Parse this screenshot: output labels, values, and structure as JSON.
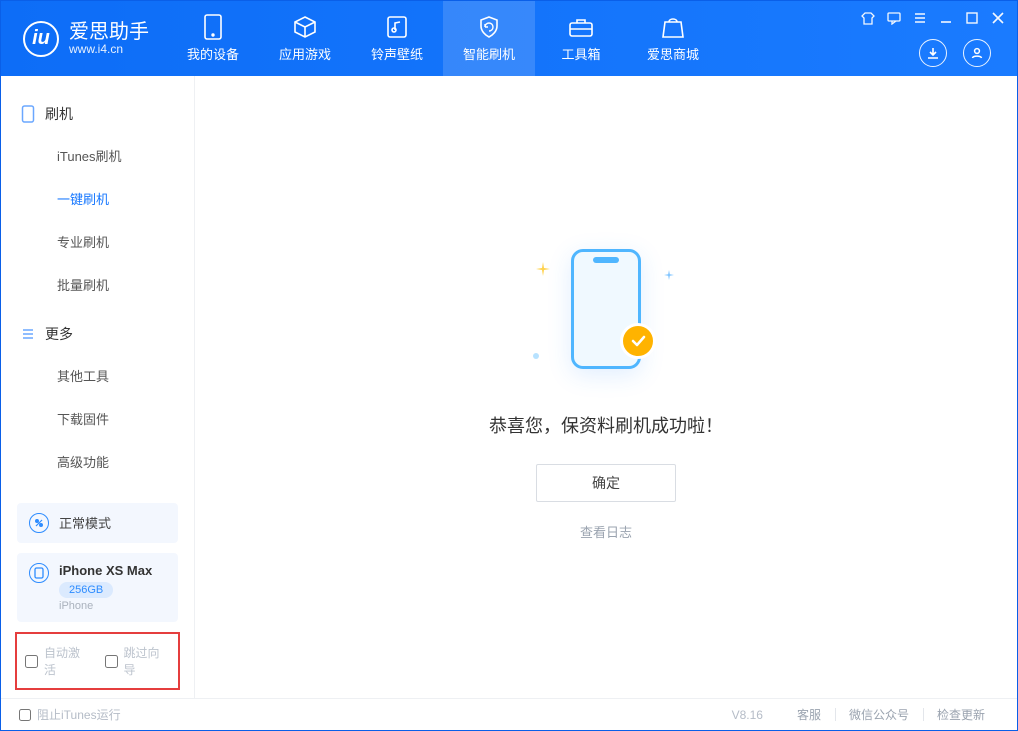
{
  "brand": {
    "name": "爱思助手",
    "url": "www.i4.cn"
  },
  "tabs": [
    {
      "label": "我的设备",
      "icon": "device"
    },
    {
      "label": "应用游戏",
      "icon": "cube"
    },
    {
      "label": "铃声壁纸",
      "icon": "music"
    },
    {
      "label": "智能刷机",
      "icon": "shield",
      "active": true
    },
    {
      "label": "工具箱",
      "icon": "toolbox"
    },
    {
      "label": "爱思商城",
      "icon": "bag"
    }
  ],
  "sidebar": {
    "g1": {
      "title": "刷机",
      "items": [
        "iTunes刷机",
        "一键刷机",
        "专业刷机",
        "批量刷机"
      ],
      "active_index": 1
    },
    "g2": {
      "title": "更多",
      "items": [
        "其他工具",
        "下载固件",
        "高级功能"
      ]
    },
    "mode_card": {
      "label": "正常模式"
    },
    "device_card": {
      "name": "iPhone XS Max",
      "storage": "256GB",
      "type": "iPhone"
    },
    "chk1": "自动激活",
    "chk2": "跳过向导"
  },
  "main": {
    "msg": "恭喜您，保资料刷机成功啦！",
    "ok": "确定",
    "log": "查看日志"
  },
  "footer": {
    "block_itunes": "阻止iTunes运行",
    "version": "V8.16",
    "links": [
      "客服",
      "微信公众号",
      "检查更新"
    ]
  }
}
